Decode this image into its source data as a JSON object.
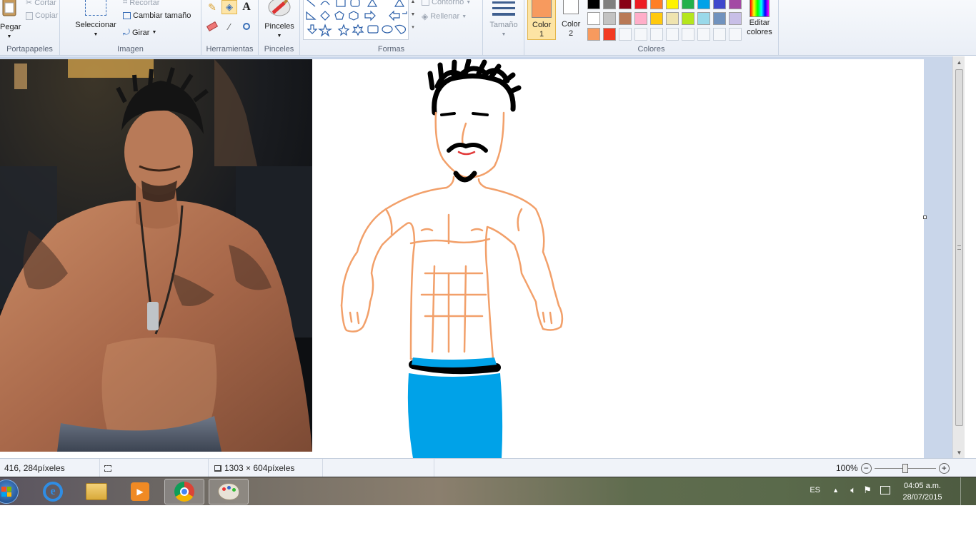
{
  "ribbon": {
    "clipboard": {
      "paste": "Pegar",
      "cut": "Cortar",
      "copy": "Copiar",
      "label": "Portapapeles"
    },
    "image": {
      "select": "Seleccionar",
      "crop": "Recortar",
      "resize": "Cambiar tamaño",
      "rotate": "Girar",
      "label": "Imagen"
    },
    "tools": {
      "label": "Herramientas"
    },
    "brushes": {
      "label": "Pinceles"
    },
    "shapes": {
      "outline": "Contorno",
      "fill": "Rellenar",
      "label": "Formas"
    },
    "size": {
      "label": "Tamaño"
    },
    "colors": {
      "color1": "Color 1",
      "color2": "Color 2",
      "edit": "Editar colores",
      "label": "Colores",
      "color1_value": "#f79a5e",
      "color2_value": "#ffffff",
      "palette_row1": [
        "#000000",
        "#7f7f7f",
        "#880015",
        "#ed1c24",
        "#ff7f27",
        "#fff200",
        "#22b14c",
        "#00a2e8",
        "#3f48cc",
        "#a349a4"
      ],
      "palette_row2": [
        "#ffffff",
        "#c3c3c3",
        "#b97a57",
        "#ffaec9",
        "#ffc90e",
        "#efe4b0",
        "#b5e61d",
        "#99d9ea",
        "#7092be",
        "#c8bfe7"
      ],
      "palette_row3": [
        "#f79a5e",
        "#f23a22"
      ]
    }
  },
  "status": {
    "cursor": "416, 284píxeles",
    "size": "1303 × 604píxeles",
    "zoom": "100%",
    "zoom_fraction": 0.5
  },
  "taskbar": {
    "lang": "ES",
    "time": "04:05 a.m.",
    "date": "28/07/2015"
  },
  "colors": {
    "skin_stroke": "#f2a06a",
    "hair": "#000000",
    "jeans": "#00a2e8",
    "belt": "#000000"
  }
}
